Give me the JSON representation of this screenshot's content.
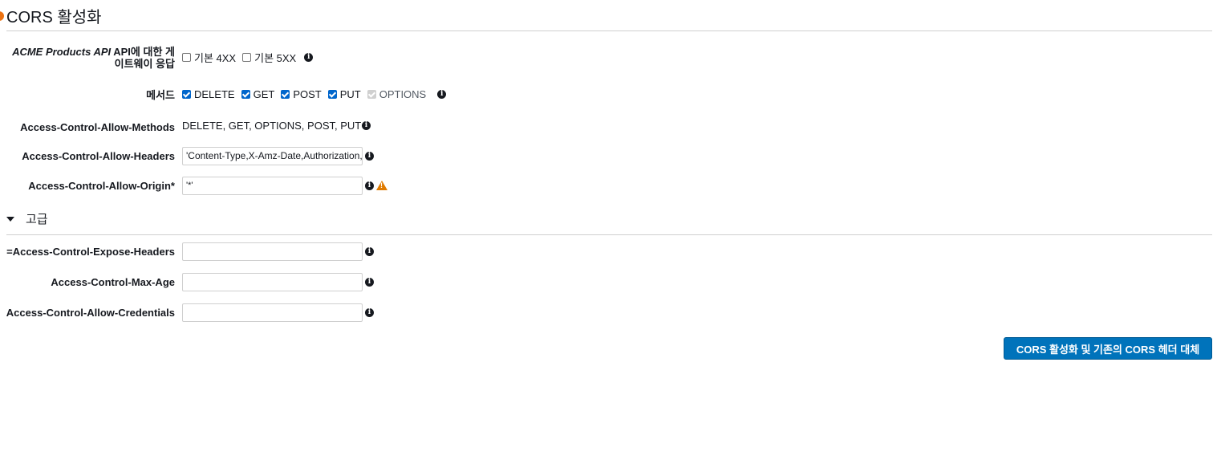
{
  "title": "CORS 활성화",
  "gateway_responses": {
    "label_italic": "ACME Products API",
    "label_line1": "API에 대한 게",
    "label_line2": "이트웨이 응답",
    "options": [
      {
        "label": "기본 4XX",
        "checked": false
      },
      {
        "label": "기본 5XX",
        "checked": false
      }
    ]
  },
  "methods": {
    "label": "메서드",
    "options": [
      {
        "label": "DELETE",
        "checked": true
      },
      {
        "label": "GET",
        "checked": true
      },
      {
        "label": "POST",
        "checked": true
      },
      {
        "label": "PUT",
        "checked": true
      },
      {
        "label": "OPTIONS",
        "checked": true,
        "disabled": true
      }
    ]
  },
  "allow_methods": {
    "label": "Access-Control-Allow-Methods",
    "value": "DELETE, GET, OPTIONS, POST, PUT"
  },
  "allow_headers": {
    "label": "Access-Control-Allow-Headers",
    "value": "'Content-Type,X-Amz-Date,Authorization,X-Api-Key,X-Amz-Security-Token'"
  },
  "allow_origin": {
    "label": "Access-Control-Allow-Origin*",
    "value": "'*'"
  },
  "advanced": {
    "label": "고급"
  },
  "expose_headers": {
    "label": "=Access-Control-Expose-Headers",
    "value": ""
  },
  "max_age": {
    "label": "Access-Control-Max-Age",
    "value": ""
  },
  "allow_credentials": {
    "label": "Access-Control-Allow-Credentials",
    "value": ""
  },
  "submit_button": "CORS 활성화 및 기존의 CORS 헤더 대체",
  "icons": {
    "info": "info-icon",
    "warning": "warning-icon",
    "caret": "caret-down-icon"
  },
  "colors": {
    "accent": "#0073bb",
    "checkbox": "#0066cc",
    "warning": "#e07b00",
    "status_dot": "#ec7211"
  }
}
